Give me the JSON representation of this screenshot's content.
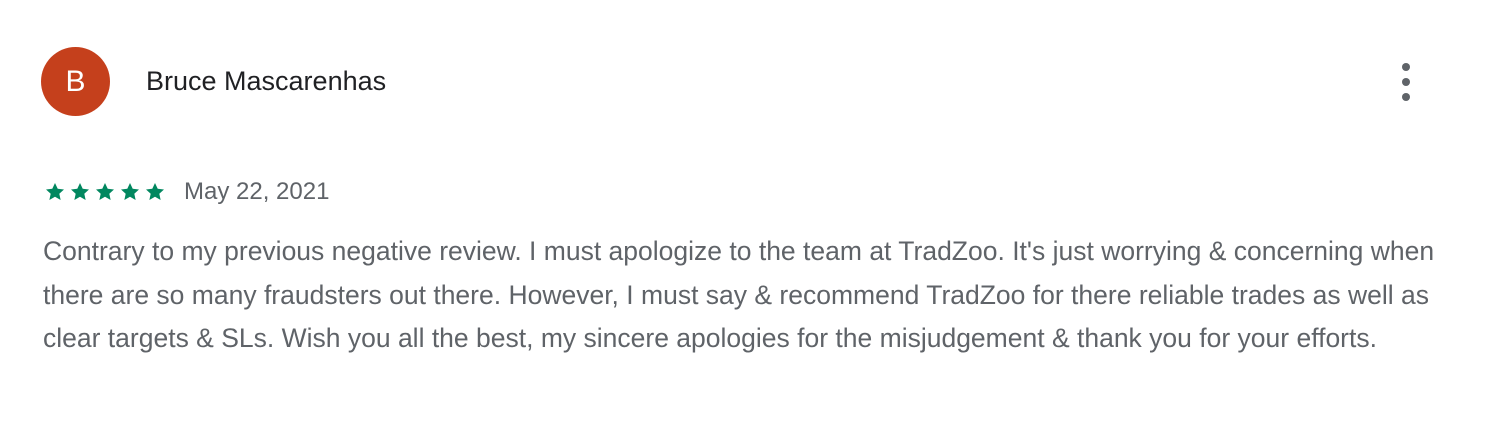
{
  "review": {
    "avatar_letter": "B",
    "avatar_color": "#c5401c",
    "author_name": "Bruce Mascarenhas",
    "menu_icon": "more-vert-icon",
    "rating": 5,
    "rating_max": 5,
    "star_color": "#01875f",
    "date": "May 22, 2021",
    "text": "Contrary to my previous negative review. I must apologize to the team at TradZoo. It's just worrying & concerning when there are so many fraudsters out there. However, I must say & recommend TradZoo for there reliable trades as well as clear targets & SLs. Wish you all the best, my sincere apologies for the misjudgement & thank you for your efforts."
  }
}
